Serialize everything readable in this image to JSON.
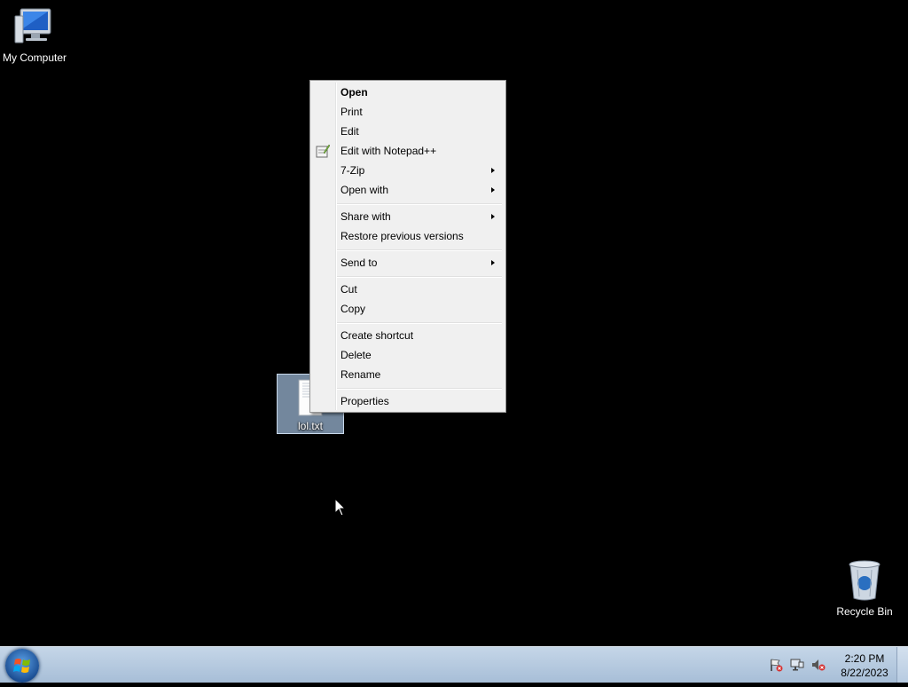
{
  "desktop": {
    "icons": {
      "my_computer": "My Computer",
      "file": "lol.txt",
      "recycle_bin": "Recycle Bin"
    }
  },
  "context_menu": {
    "items": [
      {
        "label": "Open",
        "bold": true
      },
      {
        "label": "Print"
      },
      {
        "label": "Edit"
      },
      {
        "label": "Edit with Notepad++",
        "icon": "notepad-plus-plus-icon"
      },
      {
        "label": "7-Zip",
        "submenu": true
      },
      {
        "label": "Open with",
        "submenu": true
      },
      {
        "label": "Share with",
        "submenu": true
      },
      {
        "label": "Restore previous versions"
      },
      {
        "label": "Send to",
        "submenu": true
      },
      {
        "label": "Cut"
      },
      {
        "label": "Copy"
      },
      {
        "label": "Create shortcut"
      },
      {
        "label": "Delete"
      },
      {
        "label": "Rename"
      },
      {
        "label": "Properties"
      }
    ]
  },
  "taskbar": {
    "time": "2:20 PM",
    "date": "8/22/2023",
    "tray_icons": [
      "action-center-flag-icon",
      "network-icon",
      "volume-muted-icon"
    ]
  },
  "colors": {
    "desktop_bg": "#000000",
    "menu_bg": "#f0f0f0",
    "selection": "#99b4d1",
    "taskbar": "#b4c8de"
  }
}
